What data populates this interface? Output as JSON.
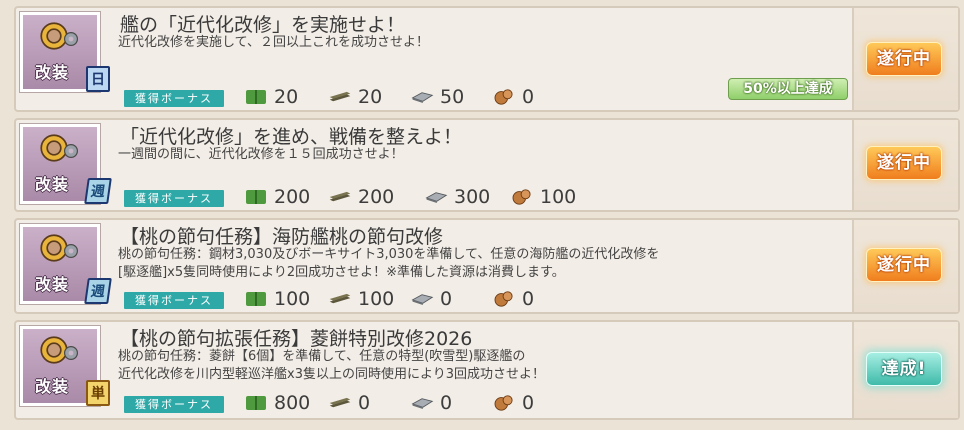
{
  "labels": {
    "category": "改装",
    "bonus": "獲得ボーナス"
  },
  "quests": [
    {
      "title": "艦の「近代化改修」を実施せよ！",
      "desc_lines": [
        "近代化改修を実施して、２回以上これを成功させよ！"
      ],
      "type": "日",
      "fuel": "20",
      "ammo": "20",
      "steel": "50",
      "bauxite": "0",
      "status": "遂行中",
      "progress": "50%以上達成"
    },
    {
      "title": "「近代化改修」を進め、戦備を整えよ！",
      "desc_lines": [
        "一週間の間に、近代化改修を１５回成功させよ！"
      ],
      "type": "週",
      "fuel": "200",
      "ammo": "200",
      "steel": "300",
      "bauxite": "100",
      "status": "遂行中"
    },
    {
      "title": "【桃の節句任務】海防艦桃の節句改修",
      "desc_lines": [
        "桃の節句任務：鋼材3,030及びボーキサイト3,030を準備して、任意の海防艦の近代化改修を",
        "[駆逐艦]x5隻同時使用により2回成功させよ！※準備した資源は消費します。"
      ],
      "type": "週",
      "fuel": "100",
      "ammo": "100",
      "steel": "0",
      "bauxite": "0",
      "status": "遂行中"
    },
    {
      "title": "【桃の節句拡張任務】菱餅特別改修2026",
      "desc_lines": [
        "桃の節句任務：菱餅【6個】を準備して、任意の特型(吹雪型)駆逐艦の",
        "近代化改修を川内型軽巡洋艦x3隻以上の同時使用により3回成功させよ！"
      ],
      "type": "単",
      "fuel": "800",
      "ammo": "0",
      "steel": "0",
      "bauxite": "0",
      "status": "達成!"
    }
  ]
}
